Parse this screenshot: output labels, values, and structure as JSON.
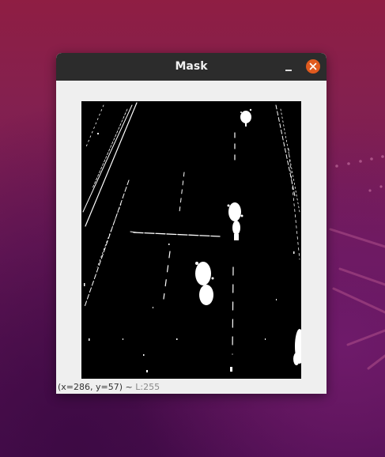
{
  "window": {
    "title": "Mask",
    "minimize_symbol": "–",
    "close_icon": "close-x-icon",
    "close_color": "#e05a1e",
    "titlebar_color": "#2c2c2c"
  },
  "image": {
    "description_kind": "binary-mask",
    "foreground_color": "#ffffff",
    "background_color": "#000000"
  },
  "status": {
    "coords": "(x=286, y=57) ~",
    "level": "L:255"
  }
}
